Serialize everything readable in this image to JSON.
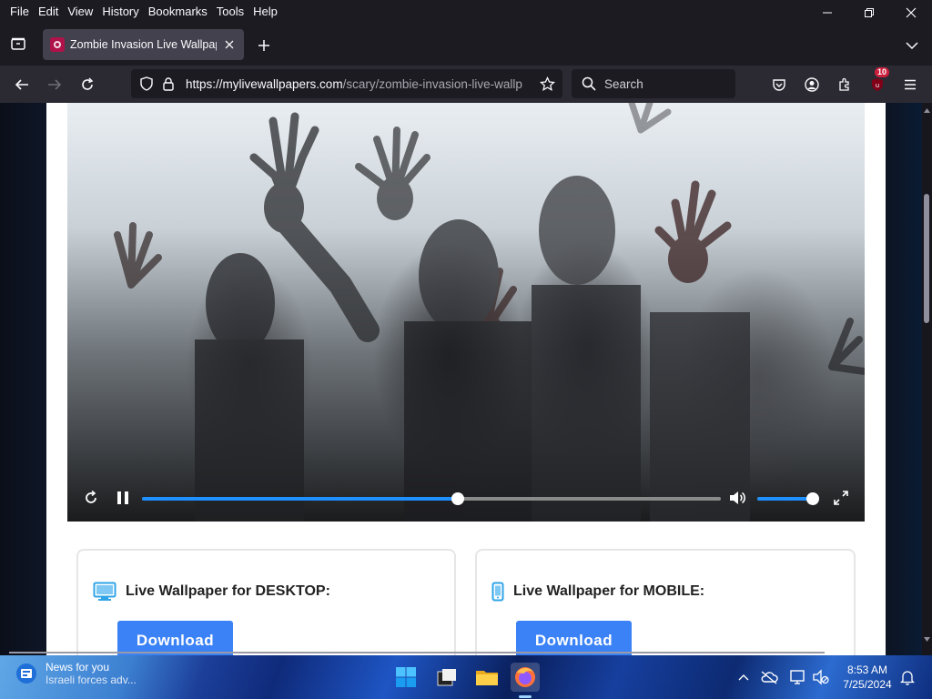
{
  "menubar": {
    "items": [
      "File",
      "Edit",
      "View",
      "History",
      "Bookmarks",
      "Tools",
      "Help"
    ]
  },
  "tabs": [
    {
      "title": "Zombie Invasion Live Wallpaper"
    }
  ],
  "navbar": {
    "url_host": "https://mylivewallpapers.com",
    "url_path": "/scary/zombie-invasion-live-wallp",
    "search_placeholder": "Search",
    "extension_badge": "10"
  },
  "video": {
    "progress_fraction": 0.546,
    "volume_fraction": 0.98
  },
  "cards": [
    {
      "heading": "Live Wallpaper for DESKTOP:",
      "button": "Download"
    },
    {
      "heading": "Live Wallpaper for MOBILE:",
      "button": "Download"
    }
  ],
  "taskbar": {
    "news_title": "News for you",
    "news_subtitle": "Israeli forces adv...",
    "time": "8:53 AM",
    "date": "7/25/2024"
  },
  "colors": {
    "accent": "#3b82f6",
    "progress": "#1e90ff",
    "chrome_dark": "#1c1b22",
    "toolbar": "#2b2a33"
  }
}
